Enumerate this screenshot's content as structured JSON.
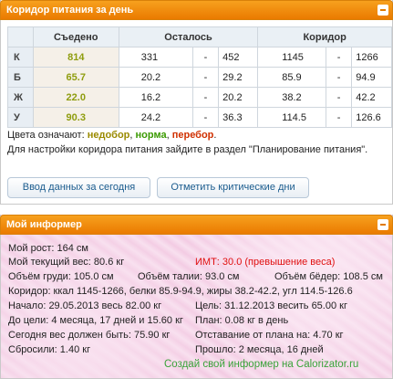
{
  "corridor": {
    "title": "Коридор питания за день",
    "headers": {
      "eaten": "Съедено",
      "left": "Осталось",
      "corridor": "Коридор"
    },
    "rows": [
      {
        "label": "К",
        "eaten": "814",
        "left_min": "331",
        "sep1": "-",
        "left_max": "452",
        "cor_min": "1145",
        "sep2": "-",
        "cor_max": "1266"
      },
      {
        "label": "Б",
        "eaten": "65.7",
        "left_min": "20.2",
        "sep1": "-",
        "left_max": "29.2",
        "cor_min": "85.9",
        "sep2": "-",
        "cor_max": "94.9"
      },
      {
        "label": "Ж",
        "eaten": "22.0",
        "left_min": "16.2",
        "sep1": "-",
        "left_max": "20.2",
        "cor_min": "38.2",
        "sep2": "-",
        "cor_max": "42.2"
      },
      {
        "label": "У",
        "eaten": "90.3",
        "left_min": "24.2",
        "sep1": "-",
        "left_max": "36.3",
        "cor_min": "114.5",
        "sep2": "-",
        "cor_max": "126.6"
      }
    ],
    "legend_prefix": "Цвета означают: ",
    "legend_under": "недобор",
    "legend_sep1": ", ",
    "legend_norm": "норма",
    "legend_sep2": ", ",
    "legend_over": "перебор",
    "legend_end": ".",
    "hint": "Для настройки коридора питания зайдите в раздел \"Планирование питания\".",
    "btn_today": "Ввод данных за сегодня",
    "btn_critical": "Отметить критические дни"
  },
  "informer": {
    "title": "Мой информер",
    "height": "Мой рост: 164 см",
    "weight": "Мой текущий вес: 80.6 кг",
    "bmi": "ИМТ: 30.0 (превышение веса)",
    "chest": "Объём груди: 105.0 см",
    "waist": "Объём талии: 93.0 см",
    "hips": "Объём бёдер: 108.5 см",
    "corridor": "Коридор: ккал 1145-1266, белки 85.9-94.9, жиры 38.2-42.2, угл 114.5-126.6",
    "start": "Начало: 29.05.2013 весь 82.00 кг",
    "goal": "Цель: 31.12.2013 весить 65.00 кг",
    "to_goal": "До цели: 4 месяца, 17 дней и 15.60 кг",
    "plan": "План: 0.08 кг в день",
    "should": "Сегодня вес должен быть: 75.90 кг",
    "lag": "Отставание от плана на: 4.70 кг",
    "lost": "Сбросили: 1.40 кг",
    "passed": "Прошло: 2 месяца, 16 дней",
    "promo": "Создай свой информер на Calorizator.ru",
    "colors": {
      "accent": "#f08c00",
      "red": "#e01010",
      "green": "#3aa33a",
      "eaten": "#8f9d0f"
    }
  }
}
